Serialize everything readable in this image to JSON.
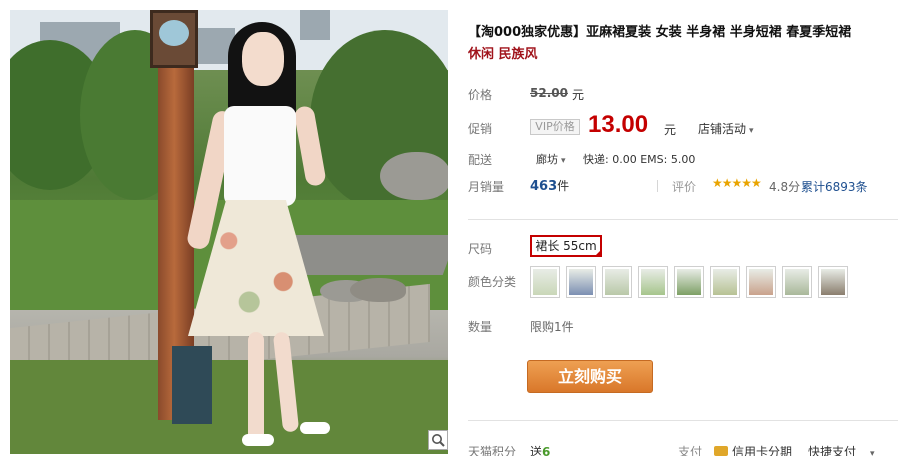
{
  "product": {
    "title_main": "【淘000独家优惠】亚麻裙夏装 女装 半身裙 半身短裙 春夏季短裙",
    "title_sub": "休闲 民族风"
  },
  "price_row": {
    "label": "价格",
    "original": "52.00",
    "unit": "元"
  },
  "promo_row": {
    "label": "促销",
    "vip_tag": "VIP价格",
    "price": "13.00",
    "unit": "元",
    "activity": "店铺活动",
    "activity_caret": "▾"
  },
  "shipping_row": {
    "label": "配送",
    "city": "廊坊",
    "city_caret": "▾",
    "fees": "快递: 0.00 EMS: 5.00"
  },
  "sales_row": {
    "label": "月销量",
    "count": "463",
    "count_unit": "件",
    "review_label": "评价",
    "stars": "★★★★★",
    "score": "4.8分",
    "cumulative": "累计6893条"
  },
  "size_row": {
    "label": "尺码",
    "selected": "裙长 55cm"
  },
  "color_row": {
    "label": "颜色分类",
    "swatches": [
      {
        "name": "swatch-1",
        "color": "#c9d7b8"
      },
      {
        "name": "swatch-2",
        "color": "#7c8fb2"
      },
      {
        "name": "swatch-3",
        "color": "#b9c8a8"
      },
      {
        "name": "swatch-4",
        "color": "#a6c58c"
      },
      {
        "name": "swatch-5",
        "color": "#7ea066"
      },
      {
        "name": "swatch-6",
        "color": "#b7c294"
      },
      {
        "name": "swatch-7",
        "color": "#c9a28c"
      },
      {
        "name": "swatch-8",
        "color": "#a9b89a"
      },
      {
        "name": "swatch-9",
        "color": "#8a7e6e"
      }
    ]
  },
  "qty_row": {
    "label": "数量",
    "limit": "限购1件"
  },
  "buy_button": {
    "label": "立刻购买"
  },
  "bottom_row": {
    "points_label": "天猫积分",
    "points_prefix": "送",
    "points_value": "6",
    "pay_label": "支付",
    "card_text": "信用卡分期",
    "quick_pay": "快捷支付",
    "quick_caret": "▾"
  },
  "photo": {
    "zoom_icon": "magnifier-icon"
  }
}
